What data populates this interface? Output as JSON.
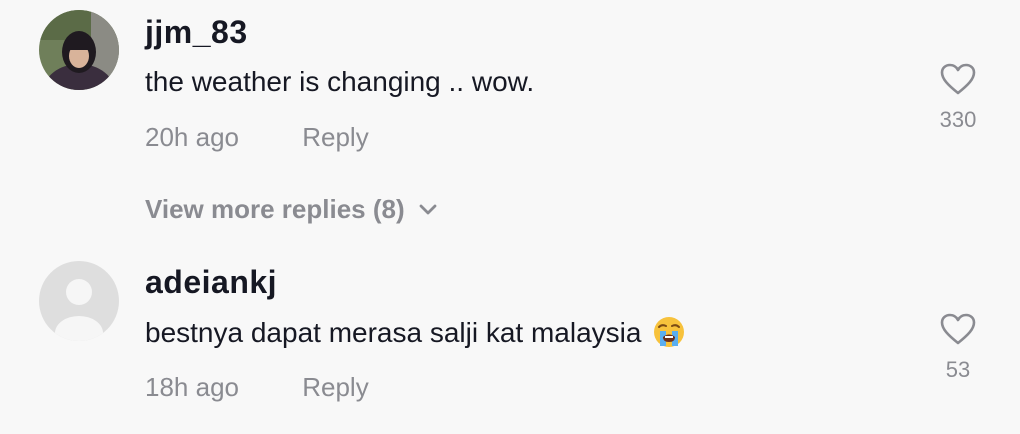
{
  "comments": [
    {
      "username": "jjm_83",
      "text": "the weather is changing .. wow.",
      "time": "20h ago",
      "reply_label": "Reply",
      "likes": "330",
      "avatar_icon": "user-photo-avatar"
    },
    {
      "username": "adeiankj",
      "text": "bestnya dapat merasa salji kat malaysia",
      "emoji": "loudly-crying-face-emoji",
      "time": "18h ago",
      "reply_label": "Reply",
      "likes": "53",
      "avatar_icon": "default-avatar-icon"
    }
  ],
  "view_more_replies": "View more replies (8)",
  "colors": {
    "background": "#f8f8f8",
    "primary_text": "#161823",
    "secondary_text": "#8a8b91"
  }
}
